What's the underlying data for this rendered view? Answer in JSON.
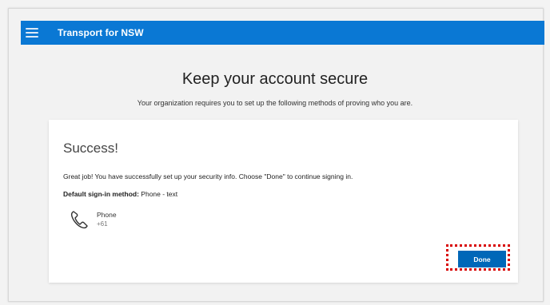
{
  "header": {
    "brand": "Transport for NSW",
    "color": "#0a78d4"
  },
  "page": {
    "title": "Keep your account secure",
    "subtitle": "Your organization requires you to set up the following methods of proving who you are."
  },
  "card": {
    "title": "Success!",
    "message": "Great job! You have successfully set up your security info. Choose \"Done\" to continue signing in.",
    "default_method_label": "Default sign-in method:",
    "default_method_value": "Phone - text",
    "method": {
      "icon": "phone-icon",
      "name": "Phone",
      "value": "+61"
    },
    "done_label": "Done",
    "done_color": "#0067b8",
    "highlight_color": "#d80000"
  }
}
